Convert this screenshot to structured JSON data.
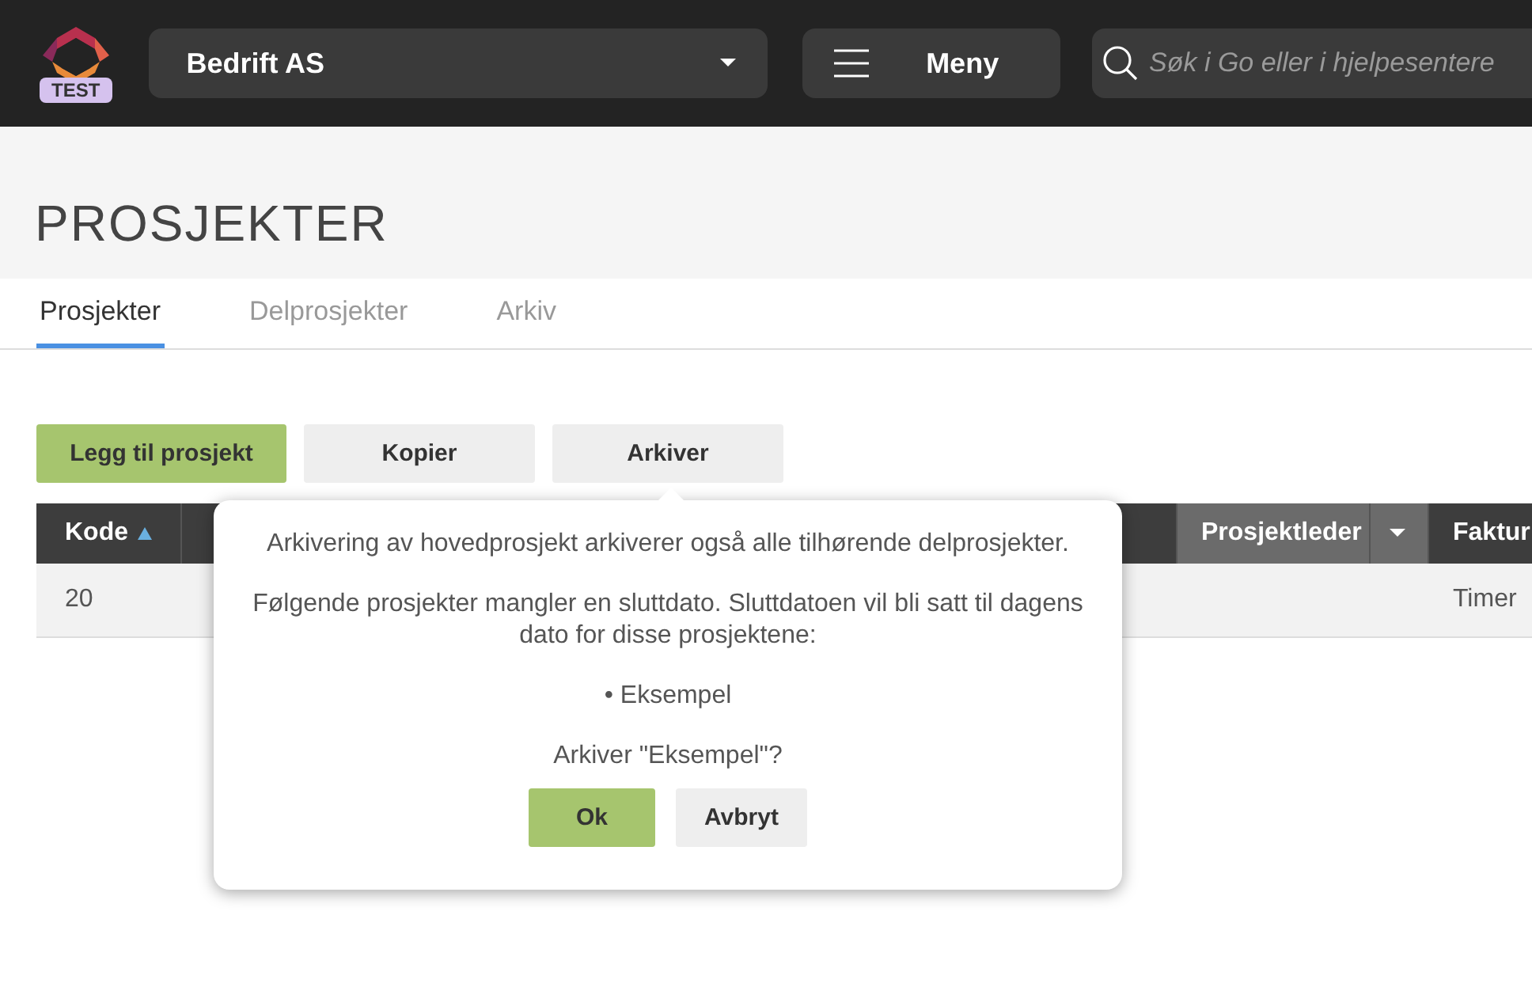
{
  "topbar": {
    "logo_badge": "TEST",
    "company": "Bedrift AS",
    "menu": "Meny",
    "search": {
      "placeholder": "Søk i Go eller i hjelpesentere"
    }
  },
  "page_title": "PROSJEKTER",
  "tabs": [
    {
      "label": "Prosjekter",
      "selected": true
    },
    {
      "label": "Delprosjekter",
      "selected": false
    },
    {
      "label": "Arkiv",
      "selected": false
    }
  ],
  "actions": [
    {
      "label": "Legg til prosjekt",
      "kind": "primary"
    },
    {
      "label": "Kopier",
      "kind": "secondary"
    },
    {
      "label": "Arkiver",
      "kind": "secondary"
    }
  ],
  "table": {
    "columns": [
      {
        "label": "Kode",
        "sorted": true,
        "kind": "text"
      },
      {
        "kind": "text"
      },
      {
        "label": "Prosjektleder",
        "kind": "filter"
      },
      {
        "label": "Faktur",
        "kind": "text"
      }
    ],
    "rows": [
      {
        "cells": [
          {
            "text": "20",
            "kind": "text"
          },
          {
            "kind": "link"
          },
          {
            "kind": "text"
          },
          {
            "text": "Timer",
            "kind": "text"
          }
        ]
      }
    ]
  },
  "dialog": {
    "paragraphs": [
      "Arkivering av hovedprosjekt arkiverer også alle tilhørende delprosjekter.",
      "Følgende prosjekter mangler en sluttdato. Sluttdatoen vil bli satt til dagens dato for disse prosjektene:",
      "• Eksempel",
      "Arkiver \"Eksempel\"?"
    ],
    "buttons": [
      {
        "label": "Ok",
        "kind": "primary"
      },
      {
        "label": "Avbryt",
        "kind": "secondary"
      }
    ]
  }
}
